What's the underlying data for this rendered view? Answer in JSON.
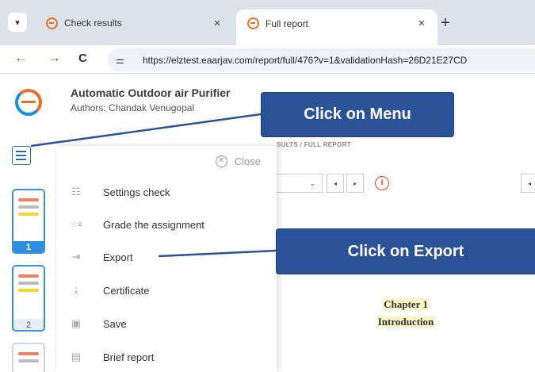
{
  "browser": {
    "tabs": [
      {
        "title": "Check results",
        "active": false
      },
      {
        "title": "Full report",
        "active": true
      }
    ],
    "new_tab_label": "+",
    "close_label": "×",
    "back_label": "←",
    "forward_label": "→",
    "reload_label": "C",
    "url": "https://elztest.eaarjav.com/report/full/476?v=1&validationHash=26D21E27CD"
  },
  "header": {
    "document_title": "Automatic Outdoor air Purifier",
    "authors": "Authors: Chandak Venugopal"
  },
  "menu": {
    "close_label": "Close",
    "items": [
      {
        "label": "Settings check",
        "icon": "sliders-icon"
      },
      {
        "label": "Grade the assignment",
        "icon": "star-list-icon"
      },
      {
        "label": "Export",
        "icon": "export-icon"
      },
      {
        "label": "Certificate",
        "icon": "download-icon"
      },
      {
        "label": "Save",
        "icon": "save-icon"
      },
      {
        "label": "Brief report",
        "icon": "report-icon"
      }
    ]
  },
  "thumbnails": [
    {
      "page": "1",
      "selected": true
    },
    {
      "page": "2",
      "selected": false
    }
  ],
  "report": {
    "breadcrumb": "SULTS / FULL REPORT",
    "info_glyph": "i",
    "chapter_title": "Chapter 1",
    "chapter_subtitle": "Introduction"
  },
  "callouts": {
    "menu": "Click on Menu",
    "export": "Click on Export"
  },
  "colors": {
    "callout_bg": "#2a5296",
    "accent_orange": "#e8702a",
    "accent_blue": "#1a8ed6",
    "alert_red": "#e74c1c"
  }
}
